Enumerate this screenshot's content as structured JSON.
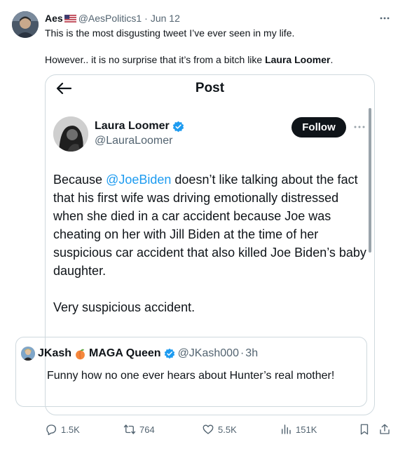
{
  "tweet": {
    "author_name": "Aes",
    "author_handle": "@AesPolitics1",
    "separator": "·",
    "date": "Jun 12",
    "text_line1": "This is the most disgusting tweet I’ve ever seen in my life.",
    "text_line2_prefix": "However.. it is no surprise that it’s from a bitch like ",
    "text_line2_bold": "Laura Loomer",
    "text_line2_suffix": "."
  },
  "embed": {
    "title": "Post",
    "author_name": "Laura Loomer",
    "author_handle": "@LauraLoomer",
    "follow_label": "Follow",
    "body_mention": "@JoeBiden",
    "body_prefix": "Because ",
    "body_rest": " doesn’t like talking about the fact that his first wife was driving emotionally distressed when she died in a car accident because Joe was cheating on her with Jill Biden at the time of her suspicious car accident that also killed Joe Biden’s baby daughter.",
    "body_second": "Very suspicious accident.",
    "quoted": {
      "name": "JKash",
      "name_suffix": "MAGA Queen",
      "handle": "@JKash000",
      "separator": "·",
      "time": "3h",
      "text": "Funny how no one ever hears about Hunter’s real mother!"
    }
  },
  "actions": {
    "replies": "1.5K",
    "retweets": "764",
    "likes": "5.5K",
    "views": "151K"
  },
  "colors": {
    "accent": "#1d9bf0",
    "secondary_text": "#536471",
    "border": "#cfd9de",
    "follow_bg": "#0f1419"
  },
  "icons": {
    "back": "arrow-left-icon",
    "verified": "verified-badge-icon",
    "more": "more-horizontal-icon",
    "reply": "reply-icon",
    "retweet": "retweet-icon",
    "like": "heart-icon",
    "views": "views-chart-icon",
    "bookmark": "bookmark-icon",
    "share": "share-icon",
    "flag": "us-flag-icon",
    "peach": "peach-emoji-icon"
  }
}
